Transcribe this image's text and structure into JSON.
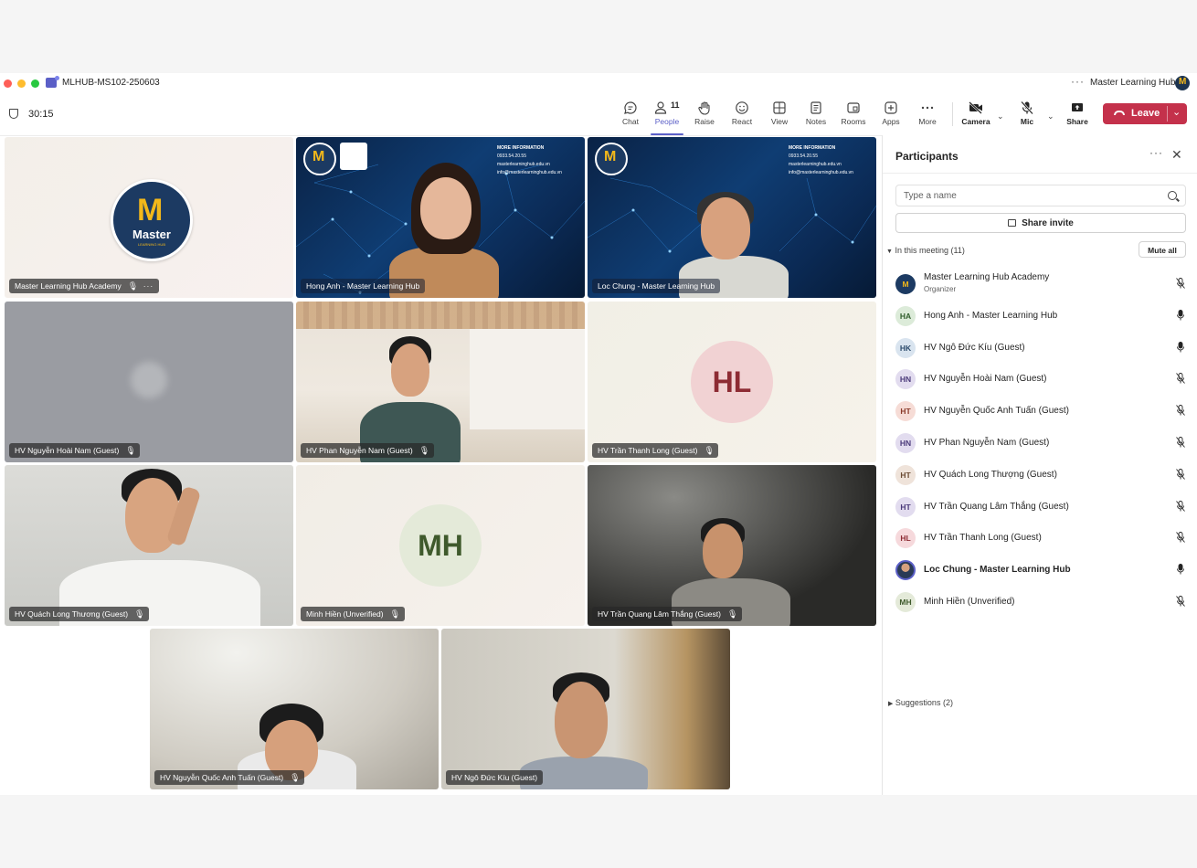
{
  "window": {
    "title": "MLHUB-MS102-250603",
    "org": "Master Learning Hub",
    "more": "···"
  },
  "toolbar": {
    "timer": "30:15",
    "people_count": "11",
    "buttons": {
      "chat": "Chat",
      "people": "People",
      "raise": "Raise",
      "react": "React",
      "view": "View",
      "notes": "Notes",
      "rooms": "Rooms",
      "apps": "Apps",
      "more": "More",
      "camera": "Camera",
      "mic": "Mic",
      "share": "Share"
    },
    "leave": "Leave"
  },
  "tiles": [
    {
      "name": "Master Learning Hub Academy",
      "logo_text": "Master",
      "logo_sub": "LEARNING HUB"
    },
    {
      "name": "Hong Anh - Master Learning Hub"
    },
    {
      "name": "Loc Chung - Master Learning Hub"
    },
    {
      "name": "HV Nguyễn Hoài Nam (Guest)"
    },
    {
      "name": "HV Phan Nguyễn Nam (Guest)"
    },
    {
      "name": "HV Trần Thanh Long (Guest)",
      "initials": "HL"
    },
    {
      "name": "HV Quách Long Thương (Guest)"
    },
    {
      "name": "Minh Hiền (Unverified)",
      "initials": "MH"
    },
    {
      "name": "HV Trần Quang Lâm Thắng (Guest)"
    },
    {
      "name": "HV Nguyễn Quốc Anh Tuấn (Guest)"
    },
    {
      "name": "HV Ngô Đức Kíu (Guest)"
    }
  ],
  "slide": {
    "more_info": "MORE INFORMATION",
    "phone": "0933.54.20.55",
    "web": "masterlearninghub.edu.vn",
    "email": "info@masterlearninghub.edu.vn"
  },
  "panel": {
    "title": "Participants",
    "search_placeholder": "Type a name",
    "share_invite": "Share invite",
    "in_meeting": "In this meeting (11)",
    "mute_all": "Mute all",
    "suggestions": "Suggestions (2)",
    "participants": [
      {
        "name": "Master Learning Hub Academy",
        "role": "Organizer",
        "initials": "M",
        "mic": "muted"
      },
      {
        "name": "Hong Anh - Master Learning Hub",
        "initials": "HA",
        "mic": "on"
      },
      {
        "name": "HV Ngô Đức Kíu (Guest)",
        "initials": "HK",
        "mic": "on"
      },
      {
        "name": "HV Nguyễn Hoài Nam (Guest)",
        "initials": "HN",
        "mic": "muted"
      },
      {
        "name": "HV Nguyễn Quốc Anh Tuấn (Guest)",
        "initials": "HT",
        "mic": "muted"
      },
      {
        "name": "HV Phan Nguyễn Nam (Guest)",
        "initials": "HN",
        "mic": "muted"
      },
      {
        "name": "HV Quách Long Thượng (Guest)",
        "initials": "HT",
        "mic": "muted"
      },
      {
        "name": "HV Trần Quang Lâm Thắng (Guest)",
        "initials": "HT",
        "mic": "muted"
      },
      {
        "name": "HV Trần Thanh Long (Guest)",
        "initials": "HL",
        "mic": "muted"
      },
      {
        "name": "Loc Chung - Master Learning Hub",
        "initials": "",
        "mic": "on"
      },
      {
        "name": "Minh Hiền (Unverified)",
        "initials": "MH",
        "mic": "muted"
      }
    ]
  },
  "colors": {
    "accent": "#5b5fc7",
    "leave": "#c4314b",
    "brand_navy": "#1c3a62",
    "brand_gold": "#f3b81a"
  }
}
